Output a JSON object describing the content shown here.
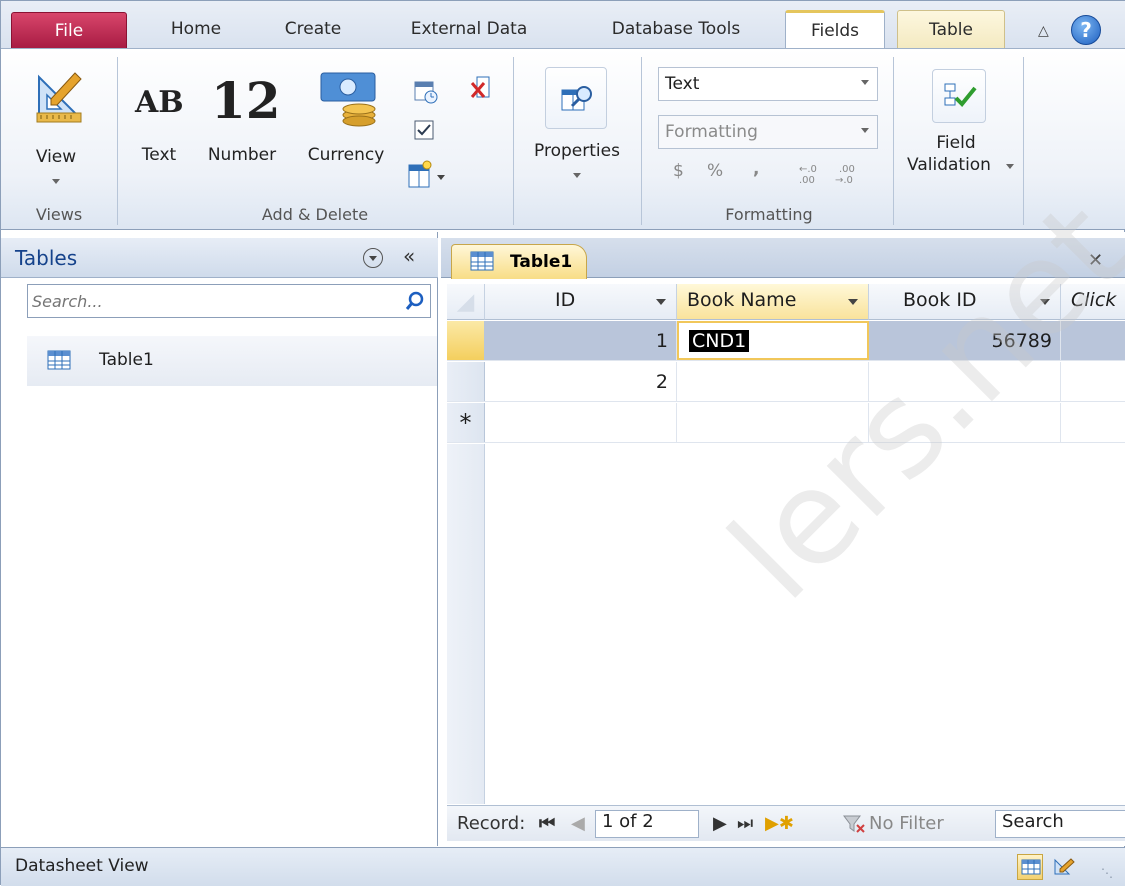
{
  "ribbon_tabs": {
    "file": "File",
    "home": "Home",
    "create": "Create",
    "external_data": "External Data",
    "database_tools": "Database Tools",
    "fields": "Fields",
    "table": "Table"
  },
  "views_group": {
    "view_label": "View",
    "group_label": "Views"
  },
  "add_delete_group": {
    "text_icon": "AB",
    "text_label": "Text",
    "number_icon": "12",
    "number_label": "Number",
    "currency_label": "Currency",
    "group_label": "Add & Delete"
  },
  "properties_group": {
    "properties_label": "Properties"
  },
  "formatting_group": {
    "data_type_value": "Text",
    "format_placeholder": "Formatting",
    "currency_symbol": "$",
    "percent_symbol": "%",
    "comma_symbol": ",",
    "group_label": "Formatting"
  },
  "validation_group": {
    "line1": "Field",
    "line2": "Validation"
  },
  "nav_pane": {
    "title": "Tables",
    "search_placeholder": "Search...",
    "items": [
      {
        "label": "Table1"
      }
    ]
  },
  "document": {
    "tab_label": "Table1",
    "columns": [
      {
        "label": "ID"
      },
      {
        "label": "Book Name"
      },
      {
        "label": "Book ID"
      },
      {
        "label": "Click"
      }
    ],
    "rows": [
      {
        "id": "1",
        "book_name": "CND1",
        "book_id": "56789"
      },
      {
        "id": "2",
        "book_name": "",
        "book_id": ""
      }
    ],
    "new_row_marker": "*"
  },
  "record_nav": {
    "label": "Record:",
    "position": "1 of 2",
    "filter": "No Filter",
    "search_placeholder": "Search"
  },
  "status_bar": {
    "text": "Datasheet View"
  },
  "watermark": "lers.net",
  "colors": {
    "file_tab": "#c4294f",
    "accent_blue": "#15428b",
    "selected_header": "#f9e39c",
    "selection_black": "#000000"
  }
}
